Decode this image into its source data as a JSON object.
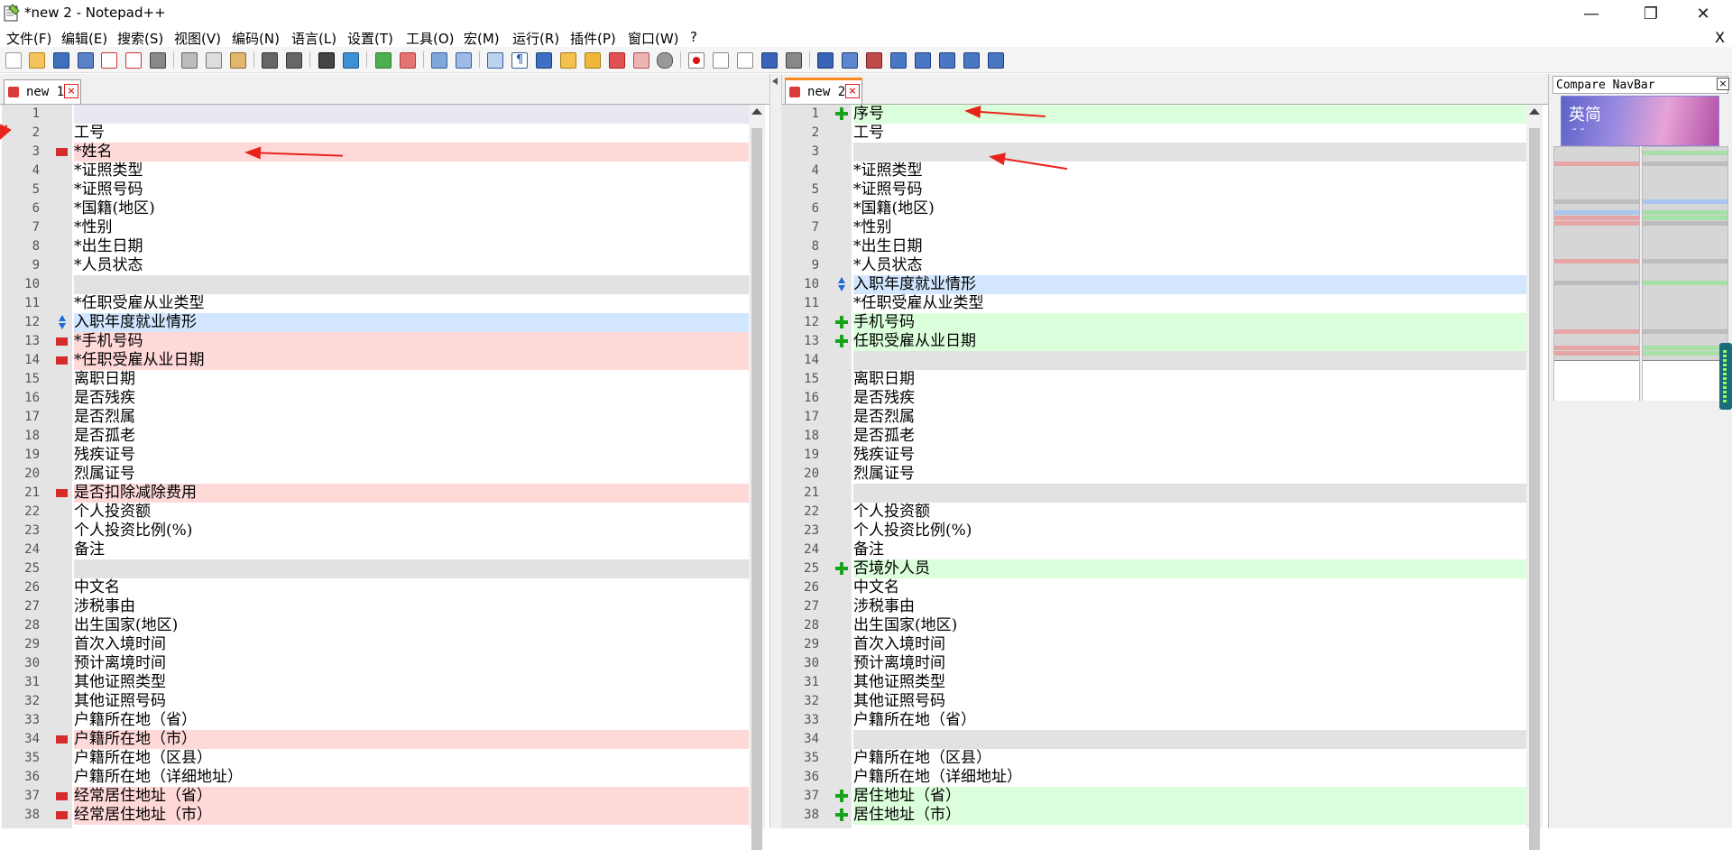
{
  "window": {
    "title": "*new 2 - Notepad++",
    "doc_close": "X"
  },
  "menu": [
    "文件(F)",
    "编辑(E)",
    "搜索(S)",
    "视图(V)",
    "编码(N)",
    "语言(L)",
    "设置(T)",
    "工具(O)",
    "宏(M)",
    "运行(R)",
    "插件(P)",
    "窗口(W)",
    "?"
  ],
  "colors": {
    "removed": "#ffd8d8",
    "added": "#dbffdb",
    "moved": "#d2e7ff",
    "blank": "#e2e2e2",
    "annotation_arrow": "#e8231c",
    "active_tab_accent": "#fa8a1e"
  },
  "left_pane": {
    "tab_label": "new 1",
    "lines": [
      {
        "n": "1",
        "text": "",
        "type": "cur"
      },
      {
        "n": "2",
        "text": "工号",
        "type": "normal"
      },
      {
        "n": "3",
        "text": "*姓名",
        "type": "removed"
      },
      {
        "n": "4",
        "text": "*证照类型",
        "type": "normal"
      },
      {
        "n": "5",
        "text": "*证照号码",
        "type": "normal"
      },
      {
        "n": "6",
        "text": "*国籍(地区)",
        "type": "normal"
      },
      {
        "n": "7",
        "text": "*性别",
        "type": "normal"
      },
      {
        "n": "8",
        "text": "*出生日期",
        "type": "normal"
      },
      {
        "n": "9",
        "text": "*人员状态",
        "type": "normal"
      },
      {
        "n": "10",
        "text": "",
        "type": "blank"
      },
      {
        "n": "11",
        "text": "*任职受雇从业类型",
        "type": "normal"
      },
      {
        "n": "12",
        "text": "入职年度就业情形",
        "type": "moved"
      },
      {
        "n": "13",
        "text": "*手机号码",
        "type": "removed"
      },
      {
        "n": "14",
        "text": "*任职受雇从业日期",
        "type": "removed"
      },
      {
        "n": "15",
        "text": "离职日期",
        "type": "normal"
      },
      {
        "n": "16",
        "text": "是否残疾",
        "type": "normal"
      },
      {
        "n": "17",
        "text": "是否烈属",
        "type": "normal"
      },
      {
        "n": "18",
        "text": "是否孤老",
        "type": "normal"
      },
      {
        "n": "19",
        "text": "残疾证号",
        "type": "normal"
      },
      {
        "n": "20",
        "text": "烈属证号",
        "type": "normal"
      },
      {
        "n": "21",
        "text": "是否扣除减除费用",
        "type": "removed"
      },
      {
        "n": "22",
        "text": "个人投资额",
        "type": "normal"
      },
      {
        "n": "23",
        "text": "个人投资比例(%)",
        "type": "normal"
      },
      {
        "n": "24",
        "text": "备注",
        "type": "normal"
      },
      {
        "n": "25",
        "text": "",
        "type": "blank"
      },
      {
        "n": "26",
        "text": "中文名",
        "type": "normal"
      },
      {
        "n": "27",
        "text": "涉税事由",
        "type": "normal"
      },
      {
        "n": "28",
        "text": "出生国家(地区)",
        "type": "normal"
      },
      {
        "n": "29",
        "text": "首次入境时间",
        "type": "normal"
      },
      {
        "n": "30",
        "text": "预计离境时间",
        "type": "normal"
      },
      {
        "n": "31",
        "text": "其他证照类型",
        "type": "normal"
      },
      {
        "n": "32",
        "text": "其他证照号码",
        "type": "normal"
      },
      {
        "n": "33",
        "text": "户籍所在地（省）",
        "type": "normal"
      },
      {
        "n": "34",
        "text": "户籍所在地（市）",
        "type": "removed"
      },
      {
        "n": "35",
        "text": "户籍所在地（区县）",
        "type": "normal"
      },
      {
        "n": "36",
        "text": "户籍所在地（详细地址）",
        "type": "normal"
      },
      {
        "n": "37",
        "text": "经常居住地址（省）",
        "type": "removed"
      },
      {
        "n": "38",
        "text": "经常居住地址（市）",
        "type": "removed"
      }
    ]
  },
  "right_pane": {
    "tab_label": "new 2",
    "lines": [
      {
        "n": "1",
        "text": "序号",
        "type": "added"
      },
      {
        "n": "2",
        "text": "工号",
        "type": "normal"
      },
      {
        "n": "3",
        "text": "",
        "type": "blank"
      },
      {
        "n": "4",
        "text": "*证照类型",
        "type": "normal"
      },
      {
        "n": "5",
        "text": "*证照号码",
        "type": "normal"
      },
      {
        "n": "6",
        "text": "*国籍(地区)",
        "type": "normal"
      },
      {
        "n": "7",
        "text": "*性别",
        "type": "normal"
      },
      {
        "n": "8",
        "text": "*出生日期",
        "type": "normal"
      },
      {
        "n": "9",
        "text": "*人员状态",
        "type": "normal"
      },
      {
        "n": "10",
        "text": "入职年度就业情形",
        "type": "moved"
      },
      {
        "n": "11",
        "text": "*任职受雇从业类型",
        "type": "normal"
      },
      {
        "n": "12",
        "text": "手机号码",
        "type": "added"
      },
      {
        "n": "13",
        "text": "任职受雇从业日期",
        "type": "added"
      },
      {
        "n": "14",
        "text": "",
        "type": "blank"
      },
      {
        "n": "15",
        "text": "离职日期",
        "type": "normal"
      },
      {
        "n": "16",
        "text": "是否残疾",
        "type": "normal"
      },
      {
        "n": "17",
        "text": "是否烈属",
        "type": "normal"
      },
      {
        "n": "18",
        "text": "是否孤老",
        "type": "normal"
      },
      {
        "n": "19",
        "text": "残疾证号",
        "type": "normal"
      },
      {
        "n": "20",
        "text": "烈属证号",
        "type": "normal"
      },
      {
        "n": "21",
        "text": "",
        "type": "blank"
      },
      {
        "n": "22",
        "text": "个人投资额",
        "type": "normal"
      },
      {
        "n": "23",
        "text": "个人投资比例(%)",
        "type": "normal"
      },
      {
        "n": "24",
        "text": "备注",
        "type": "normal"
      },
      {
        "n": "25",
        "text": "否境外人员",
        "type": "added"
      },
      {
        "n": "26",
        "text": "中文名",
        "type": "normal"
      },
      {
        "n": "27",
        "text": "涉税事由",
        "type": "normal"
      },
      {
        "n": "28",
        "text": "出生国家(地区)",
        "type": "normal"
      },
      {
        "n": "29",
        "text": "首次入境时间",
        "type": "normal"
      },
      {
        "n": "30",
        "text": "预计离境时间",
        "type": "normal"
      },
      {
        "n": "31",
        "text": "其他证照类型",
        "type": "normal"
      },
      {
        "n": "32",
        "text": "其他证照号码",
        "type": "normal"
      },
      {
        "n": "33",
        "text": "户籍所在地（省）",
        "type": "normal"
      },
      {
        "n": "34",
        "text": "",
        "type": "blank"
      },
      {
        "n": "35",
        "text": "户籍所在地（区县）",
        "type": "normal"
      },
      {
        "n": "36",
        "text": "户籍所在地（详细地址）",
        "type": "normal"
      },
      {
        "n": "37",
        "text": "居住地址（省）",
        "type": "added"
      },
      {
        "n": "38",
        "text": "居住地址（市）",
        "type": "added"
      }
    ]
  },
  "compare_navbar": {
    "title": "Compare NavBar",
    "ad_text": "英简",
    "ad_sub": "ᵕ ᵕ"
  }
}
